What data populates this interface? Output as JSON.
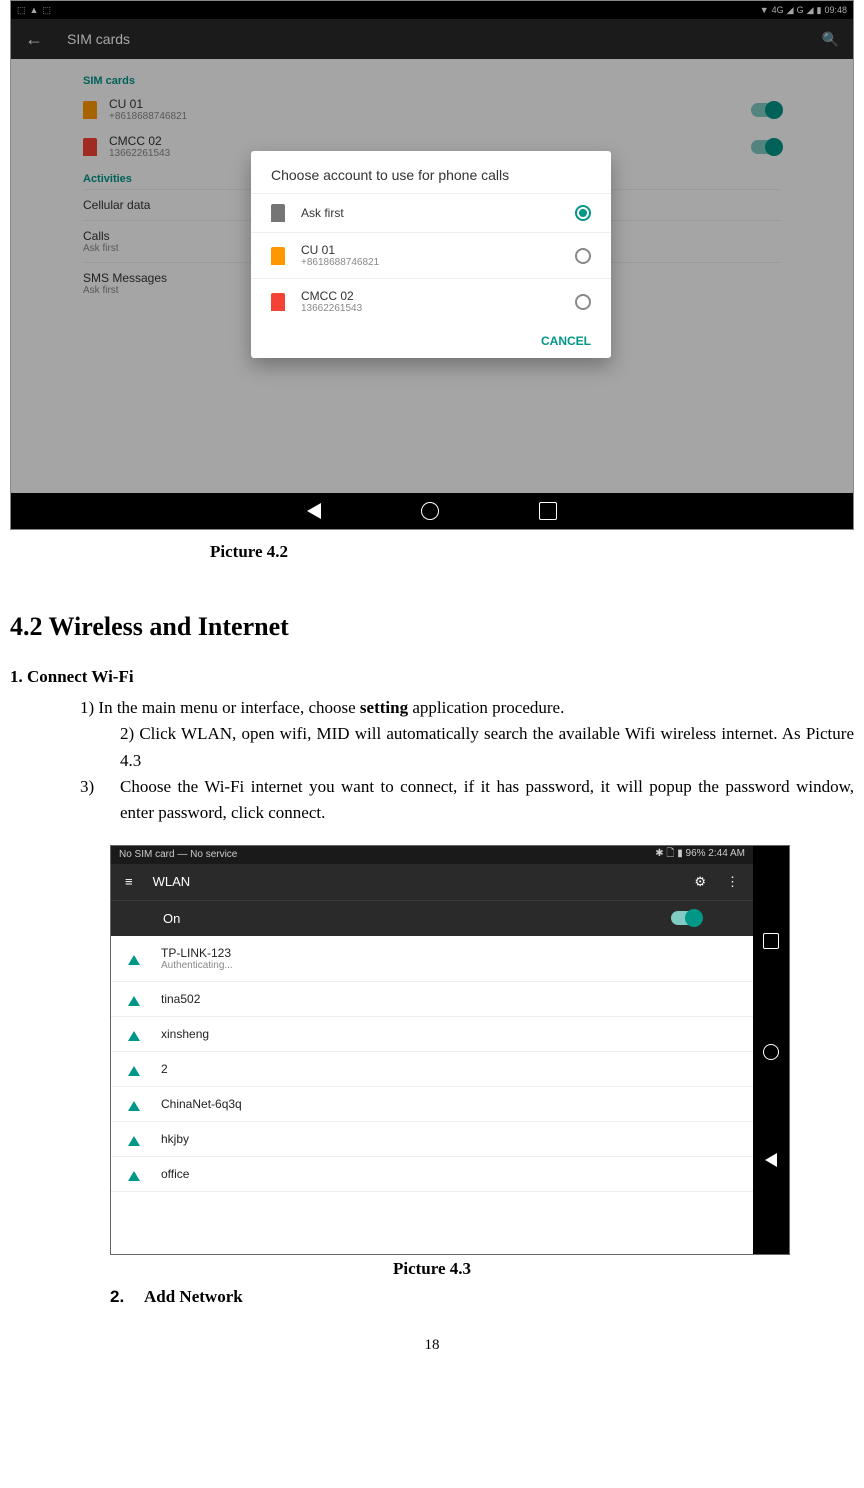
{
  "screenshot1": {
    "status": {
      "time": "09:48",
      "net1": "4G",
      "net2": "G"
    },
    "appbar": {
      "title": "SIM cards"
    },
    "sim_cards_label": "SIM cards",
    "sims": [
      {
        "name": "CU 01",
        "number": "+8618688746821"
      },
      {
        "name": "CMCC 02",
        "number": "13662261543"
      }
    ],
    "activities_label": "Activities",
    "cellular": "Cellular data",
    "calls": "Calls",
    "calls_sub": "Ask first",
    "sms": "SMS Messages",
    "sms_sub": "Ask first",
    "dialog": {
      "title": "Choose account to use for phone calls",
      "ask_first": "Ask first",
      "options": [
        {
          "name": "CU 01",
          "number": "+8618688746821"
        },
        {
          "name": "CMCC 02",
          "number": "13662261543"
        }
      ],
      "cancel": "CANCEL"
    }
  },
  "caption1": "Picture 4.2",
  "heading": "4.2 Wireless and Internet",
  "connect_heading": "1. Connect Wi-Fi",
  "step1_pre": "1) In the main menu or interface, choose ",
  "step1_bold": "setting",
  "step1_post": " application procedure.",
  "step2": "2) Click WLAN, open wifi, MID will automatically search the available Wifi wireless internet. As Picture 4.3",
  "step3_num": "3)",
  "step3": "Choose the Wi-Fi internet you want to connect, if it has password, it will popup the password window, enter password, click connect.",
  "screenshot2": {
    "status": {
      "left": "No SIM card — No service",
      "right": "96%  2:44 AM"
    },
    "appbar": {
      "title": "WLAN"
    },
    "on_label": "On",
    "networks": [
      {
        "name": "TP-LINK-123",
        "sub": "Authenticating..."
      },
      {
        "name": "tina502",
        "sub": ""
      },
      {
        "name": "xinsheng",
        "sub": ""
      },
      {
        "name": "2",
        "sub": ""
      },
      {
        "name": "ChinaNet-6q3q",
        "sub": ""
      },
      {
        "name": "hkjby",
        "sub": ""
      },
      {
        "name": "office",
        "sub": ""
      }
    ]
  },
  "caption2": "Picture 4.3",
  "add_network_num": "2.",
  "add_network": "Add Network",
  "page_number": "18"
}
